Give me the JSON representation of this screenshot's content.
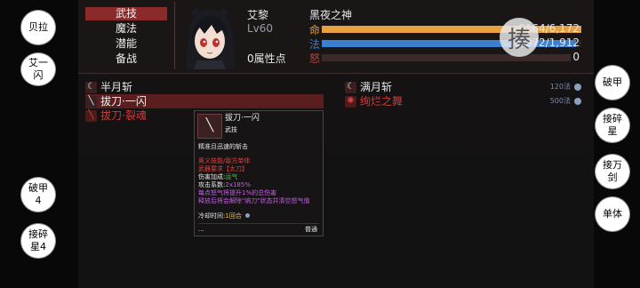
{
  "left_buttons": [
    {
      "label": "贝拉"
    },
    {
      "label": "艾一闪"
    },
    {
      "label": "破甲4"
    },
    {
      "label": "接碎星4"
    }
  ],
  "right_buttons": [
    {
      "label": "破甲"
    },
    {
      "label": "接碎星"
    },
    {
      "label": "接万剑"
    },
    {
      "label": "单体"
    }
  ],
  "menu": [
    {
      "label": "武技",
      "active": true
    },
    {
      "label": "魔法",
      "active": false
    },
    {
      "label": "潜能",
      "active": false
    },
    {
      "label": "备战",
      "active": false
    }
  ],
  "character": {
    "name": "艾黎",
    "level": "Lv60",
    "title": "黑夜之神",
    "attr_points": "0属性点"
  },
  "stats": [
    {
      "label": "命",
      "value": "6164/6,172",
      "fill": 0.999,
      "color": "#e8a040"
    },
    {
      "label": "法",
      "value": "1,872/1,912",
      "fill": 0.979,
      "color": "#3a7fd0"
    },
    {
      "label": "怒",
      "value": "0",
      "fill": 0.0,
      "color": "#c04040"
    }
  ],
  "seal_icon": "揍",
  "skills_left": [
    {
      "name": "半月斩",
      "color": "#e8e8e8",
      "icon": "crescent-icon",
      "selected": false
    },
    {
      "name": "拔刀·一闪",
      "color": "#f0f0f0",
      "icon": "slash-icon",
      "selected": true
    },
    {
      "name": "拔刀·裂魂",
      "color": "#d03a3a",
      "icon": "slash-red-icon",
      "selected": false
    }
  ],
  "skills_right": [
    {
      "name": "满月斩",
      "color": "#e8e8e8",
      "cost": "120法",
      "icon": "fullmoon-icon"
    },
    {
      "name": "绚烂之舞",
      "color": "#d03a3a",
      "cost": "500法",
      "icon": "dance-icon"
    }
  ],
  "tooltip": {
    "name": "拔刀·一闪",
    "type": "武技",
    "desc": "精准且迅速的斩击",
    "lines": [
      {
        "text": "奥义技能/敌方单体",
        "color": "#e04040"
      },
      {
        "text": "武器要求【太刀】",
        "color": "#e04040"
      },
      {
        "text": "伤害加成:运气",
        "color": "#e8e8e8",
        "accent": "运气",
        "accent_color": "#40c040"
      },
      {
        "text": "攻击系数:2x185%",
        "color": "#e8e8e8",
        "accent": "2x185%",
        "accent_color": "#c060e0"
      },
      {
        "text": "每点怒气将提升1%的总伤害",
        "color": "#c060e0"
      },
      {
        "text": "释放后将会解除\"纳刀\"状态并清空怒气值",
        "color": "#c060e0"
      }
    ],
    "cooldown_label": "冷却时间:",
    "cooldown_value": "1回合",
    "footer_left": "...",
    "footer_right": "普通"
  }
}
